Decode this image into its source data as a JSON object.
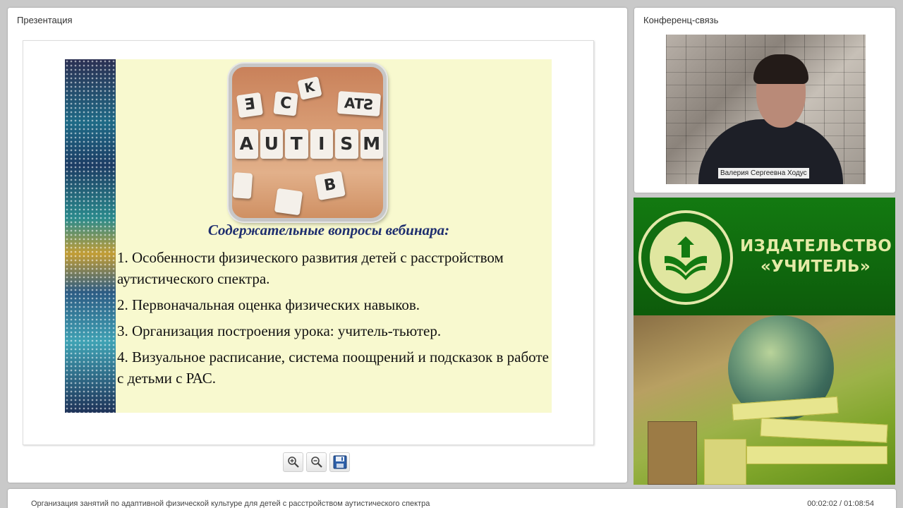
{
  "presentation": {
    "title": "Презентация",
    "slide": {
      "image_tiles": [
        "A",
        "U",
        "T",
        "I",
        "S",
        "M"
      ],
      "heading": "Содержательные вопросы вебинара:",
      "items": [
        "1. Особенности физического развития детей с расстройством аутистического спектра.",
        "2. Первоначальная оценка физических навыков.",
        "3. Организация построения урока: учитель-тьютер.",
        "4. Визуальное расписание, система поощрений и подсказок в работе с детьми с РАС."
      ]
    },
    "toolbar": {
      "zoom_in_icon": "zoom-in-icon",
      "zoom_out_icon": "zoom-out-icon",
      "save_icon": "floppy-disk-icon"
    }
  },
  "conference": {
    "title": "Конференц-связь",
    "speaker_name": "Валерия Сергеевна Ходус"
  },
  "publisher": {
    "name_line1": "ИЗДАТЕЛЬСТВО",
    "name_line2": "«УЧИТЕЛЬ»",
    "colors": {
      "green": "#137a11",
      "text": "#e4eaa6"
    }
  },
  "footer": {
    "webinar_title": "Организация занятий по адаптивной физической культуре для детей с расстройством аутистического спектра",
    "time": "00:02:02 / 01:08:54"
  }
}
